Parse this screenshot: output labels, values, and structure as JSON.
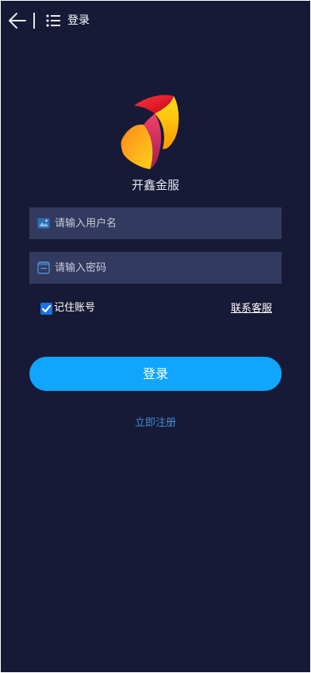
{
  "header": {
    "title": "登录",
    "back_icon": "back-arrow-icon",
    "menu_icon": "list-menu-icon"
  },
  "brand": {
    "name": "开鑫金服",
    "logo_icon": "brand-logo"
  },
  "form": {
    "username": {
      "value": "",
      "placeholder": "请输入用户名",
      "icon": "user-card-icon"
    },
    "password": {
      "value": "",
      "placeholder": "请输入密码",
      "icon": "lock-card-icon"
    },
    "remember": {
      "label": "记住账号",
      "checked": true
    },
    "support_link": "联系客服",
    "login_button": "登录",
    "register_link": "立即注册"
  },
  "colors": {
    "background": "#171a36",
    "input_bg": "#333a5f",
    "primary": "#10a5ff",
    "link": "#3f8ecf",
    "checkbox": "#1a73e8"
  }
}
